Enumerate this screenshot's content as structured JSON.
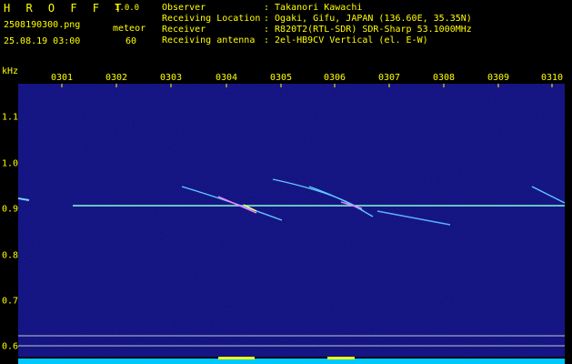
{
  "app": {
    "name": "H R O F F T",
    "version": "1.0.0"
  },
  "file": {
    "name": "2508190300.png",
    "datetime": "25.08.19 03:00"
  },
  "meteor": {
    "label": "meteor",
    "count": "60"
  },
  "info": [
    {
      "key": "Observer",
      "value": ": Takanori Kawachi"
    },
    {
      "key": "Receiving Location",
      "value": ": Ogaki, Gifu, JAPAN (136.60E, 35.35N)"
    },
    {
      "key": "Receiver",
      "value": ": R820T2(RTL-SDR) SDR-Sharp 53.1000MHz"
    },
    {
      "key": "Receiving antenna",
      "value": ": 2el-HB9CV Vertical (el. E-W)"
    }
  ],
  "axis": {
    "unit": "kHz",
    "hours": [
      "0301",
      "0302",
      "0303",
      "0304",
      "0305",
      "0306",
      "0307",
      "0308",
      "0309",
      "0310"
    ],
    "freqs": [
      "1.1",
      "1.0",
      "0.9",
      "0.8",
      "0.7",
      "0.6"
    ]
  },
  "colors": {
    "text": "#ffff00",
    "bg": "#00005a",
    "carrier": "#80ffd0",
    "spectrum": "#00c8ff"
  }
}
